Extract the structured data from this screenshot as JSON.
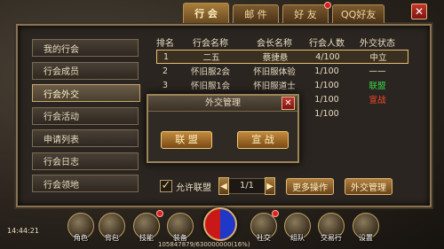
{
  "top_tabs": [
    {
      "label": "行 会",
      "active": true
    },
    {
      "label": "邮 件",
      "active": false
    },
    {
      "label": "好 友",
      "active": false,
      "badge": true
    },
    {
      "label": "QQ好友",
      "active": false
    }
  ],
  "close_symbol": "✕",
  "sidebar": {
    "items": [
      {
        "label": "我的行会",
        "active": false
      },
      {
        "label": "行会成员",
        "active": false
      },
      {
        "label": "行会外交",
        "active": true
      },
      {
        "label": "行会活动",
        "active": false
      },
      {
        "label": "申请列表",
        "active": false
      },
      {
        "label": "行会日志",
        "active": false
      },
      {
        "label": "行会领地",
        "active": false
      }
    ]
  },
  "table": {
    "headers": [
      "排名",
      "行会名称",
      "会长名称",
      "行会人数",
      "外交状态"
    ],
    "rows": [
      {
        "rank": "1",
        "guild": "二五",
        "leader": "蔡捷悬",
        "members": "4/100",
        "status": "中立",
        "status_type": "neutral"
      },
      {
        "rank": "2",
        "guild": "怀旧服2会",
        "leader": "怀旧服体验",
        "members": "1/100",
        "status": "——",
        "status_type": "neutral"
      },
      {
        "rank": "3",
        "guild": "怀旧服1会",
        "leader": "怀旧服道士",
        "members": "1/100",
        "status": "联盟",
        "status_type": "ally"
      },
      {
        "rank": "",
        "guild": "",
        "leader": "",
        "members": "1/100",
        "status": "宣战",
        "status_type": "war"
      },
      {
        "rank": "",
        "guild": "",
        "leader": "",
        "members": "1/100",
        "status": "",
        "status_type": "neutral"
      }
    ]
  },
  "bottom": {
    "allow_alliance_label": "允许联盟",
    "checkbox_mark": "✓",
    "page": "1/1",
    "prev": "◀",
    "next": "▶",
    "more_ops": "更多操作",
    "diplomacy_manage": "外交管理"
  },
  "modal": {
    "title": "外交管理",
    "close": "✕",
    "ally_button": "联 盟",
    "war_button": "宣 战"
  },
  "hud": {
    "time": "14:44:21",
    "exp": "105847879/630000000(16%)",
    "items": [
      {
        "label": "角色"
      },
      {
        "label": "背包"
      },
      {
        "label": "技能"
      },
      {
        "label": "装备"
      },
      {
        "label": "社交"
      },
      {
        "label": "组队"
      },
      {
        "label": "交易行"
      },
      {
        "label": "设置"
      }
    ]
  }
}
